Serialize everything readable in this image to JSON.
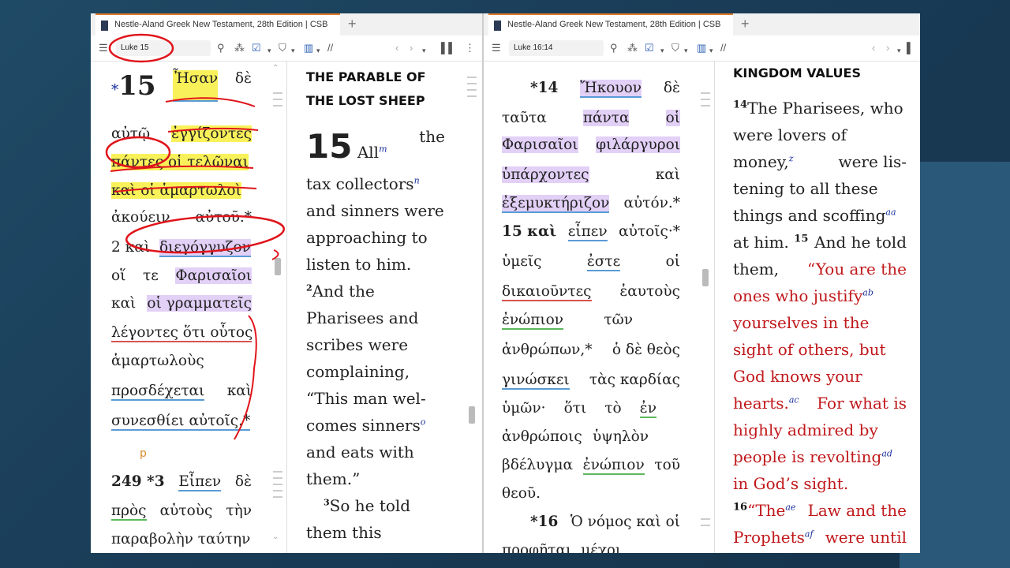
{
  "left": {
    "tab_title": "Nestle-Aland Greek New Testament, 28th Edition | CSB",
    "reference": "Luke 15",
    "heading": "THE PARABLE OF THE LOST SHEEP",
    "greek": [
      [
        "*15",
        "Ἦσαν",
        "δὲ"
      ],
      [
        "αὐτῷ",
        "ἐγγίζοντες"
      ],
      [
        "πάντες οἱ τελῶναι"
      ],
      [
        "καὶ οἱ ἁμαρτωλοὶ"
      ],
      [
        "ἀκούειν",
        "αὐτοῦ.*"
      ],
      [
        "2 καὶ",
        "διεγόγγυζον"
      ],
      [
        "οἵ",
        "τε",
        "Φαρισαῖοι"
      ],
      [
        "καὶ",
        "οἱ γραμματεῖς"
      ],
      [
        "λέγοντες ὅτι οὗτος"
      ],
      [
        "ἁμαρτωλοὺς"
      ],
      [
        "προσδέχεται",
        "καὶ"
      ],
      [
        "συνεσθίει αὐτοῖς.*"
      ],
      [
        "p"
      ],
      [
        "249 *3",
        "Εἶπεν",
        "δὲ"
      ],
      [
        "πρὸς",
        "αὐτοὺς",
        "τὴν"
      ],
      [
        "παραβολὴν ταύτην"
      ]
    ],
    "english": [
      [
        "15",
        "All",
        "m",
        "the"
      ],
      [
        "tax collectors",
        "n"
      ],
      [
        "and sinners were"
      ],
      [
        "approaching to"
      ],
      [
        "listen to him."
      ],
      [
        "2",
        "And the"
      ],
      [
        "Pharisees and"
      ],
      [
        "scribes were"
      ],
      [
        "complaining,"
      ],
      [
        "“This man wel-"
      ],
      [
        "comes sinners",
        "o"
      ],
      [
        "and eats with"
      ],
      [
        "them.”"
      ],
      [
        "3",
        "So he told"
      ],
      [
        "them this"
      ]
    ]
  },
  "right": {
    "tab_title": "Nestle-Aland Greek New Testament, 28th Edition | CSB",
    "reference": "Luke 16:14",
    "heading": "KINGDOM VALUES",
    "greek": [
      [
        "*14",
        "Ἤκουον",
        "δὲ"
      ],
      [
        "ταῦτα",
        "πάντα",
        "οἱ"
      ],
      [
        "Φαρισαῖοι",
        "φιλάργυροι"
      ],
      [
        "ὑπάρχοντες",
        "καὶ"
      ],
      [
        "ἐξεμυκτήριζον",
        "αὐτόν.*"
      ],
      [
        "15 καὶ",
        "εἶπεν",
        "αὐτοῖς·*"
      ],
      [
        "ὑμεῖς",
        "ἐστε",
        "οἱ"
      ],
      [
        "δικαιοῦντες",
        "ἑαυτοὺς"
      ],
      [
        "ἐνώπιον",
        "τῶν"
      ],
      [
        "ἀνθρώπων,*",
        "ὁ δὲ θεὸς"
      ],
      [
        "γινώσκει",
        "τὰς καρδίας"
      ],
      [
        "ὑμῶν·",
        "ὅτι",
        "τὸ",
        "ἐν"
      ],
      [
        "ἀνθρώποις",
        "ὑψηλὸν"
      ],
      [
        "βδέλυγμα",
        "ἐνώπιον",
        "τοῦ"
      ],
      [
        "θεοῦ."
      ],
      [
        "*16",
        "Ὁ νόμος καὶ οἱ"
      ],
      [
        "προφῆται",
        "μέχρι"
      ]
    ],
    "english": [
      [
        "14",
        "The Pharisees, who"
      ],
      [
        "were lovers of"
      ],
      [
        "money,",
        "z",
        "were lis-"
      ],
      [
        "tening to all these"
      ],
      [
        "things and scoffing",
        "aa"
      ],
      [
        "at him.",
        "15",
        "And he told"
      ],
      [
        "them,",
        "“You are the"
      ],
      [
        "ones who justify",
        "ab"
      ],
      [
        "yourselves in the"
      ],
      [
        "sight of others, but"
      ],
      [
        "God knows your"
      ],
      [
        "hearts.",
        "ac",
        "For what is"
      ],
      [
        "highly admired by"
      ],
      [
        "people is revolting",
        "ad"
      ],
      [
        "in God’s sight."
      ],
      [
        "16",
        "“The",
        "ae",
        "Law and the"
      ],
      [
        "Prophets",
        "af",
        "were until"
      ]
    ]
  },
  "colors": {
    "highlight_yellow": "#f9f15a",
    "highlight_purple": "#e2d0f7",
    "words_of_jesus": "#c0181b",
    "annotation_red": "#e0141b"
  }
}
